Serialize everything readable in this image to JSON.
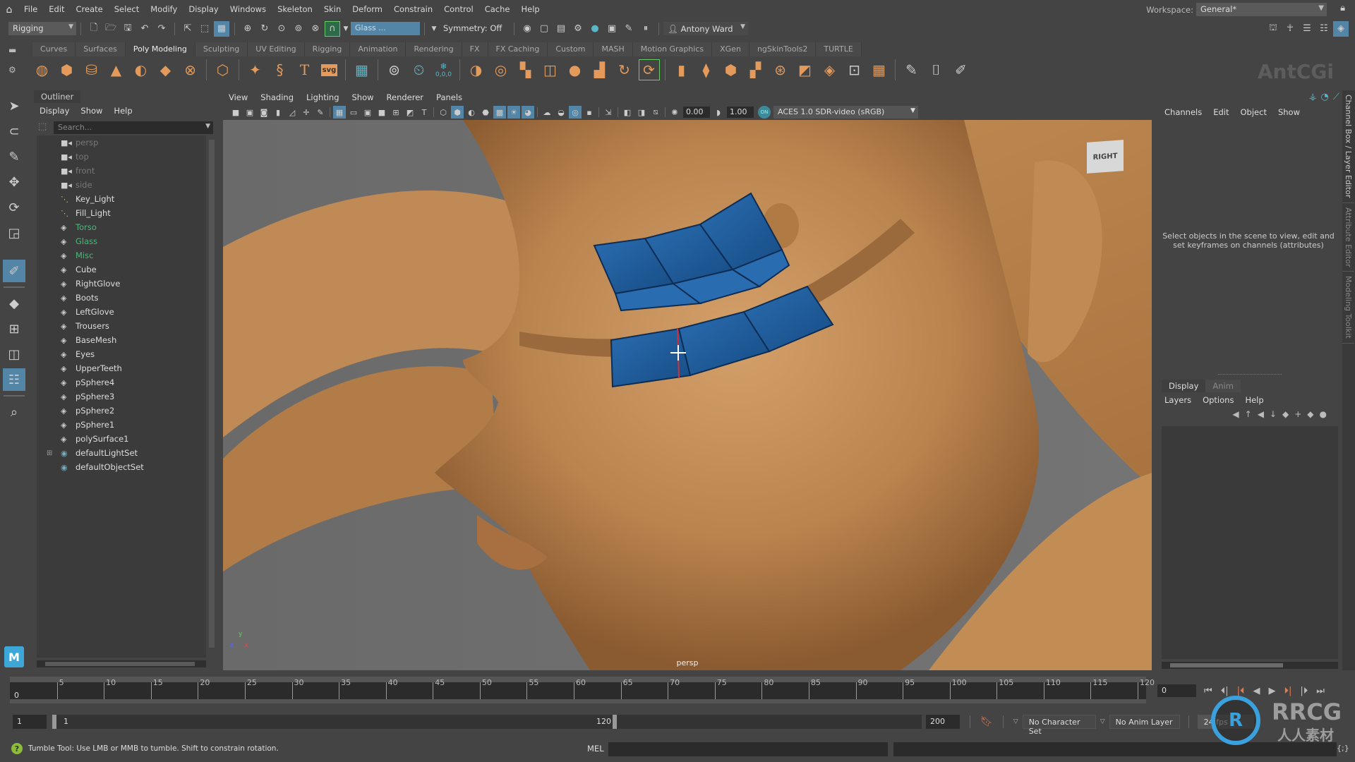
{
  "menubar": {
    "items": [
      "File",
      "Edit",
      "Create",
      "Select",
      "Modify",
      "Display",
      "Windows",
      "Skeleton",
      "Skin",
      "Deform",
      "Constrain",
      "Control",
      "Cache",
      "Help"
    ],
    "workspace_label": "Workspace:",
    "workspace_value": "General*"
  },
  "statusline": {
    "mode": "Rigging",
    "selection_field": "Glass ...",
    "symmetry": "Symmetry: Off",
    "user": "Antony Ward"
  },
  "shelf": {
    "tabs": [
      "Curves",
      "Surfaces",
      "Poly Modeling",
      "Sculpting",
      "UV Editing",
      "Rigging",
      "Animation",
      "Rendering",
      "FX",
      "FX Caching",
      "Custom",
      "MASH",
      "Motion Graphics",
      "XGen",
      "ngSkinTools2",
      "TURTLE"
    ],
    "active_tab": "Poly Modeling",
    "reset_label": "0,0,0",
    "svg_label": "svg"
  },
  "outliner": {
    "title": "Outliner",
    "menu": [
      "Display",
      "Show",
      "Help"
    ],
    "search_placeholder": "Search...",
    "items": [
      {
        "name": "persp",
        "type": "camera",
        "style": "dim"
      },
      {
        "name": "top",
        "type": "camera",
        "style": "dim"
      },
      {
        "name": "front",
        "type": "camera",
        "style": "dim"
      },
      {
        "name": "side",
        "type": "camera",
        "style": "dim"
      },
      {
        "name": "Key_Light",
        "type": "light",
        "style": "normal"
      },
      {
        "name": "Fill_Light",
        "type": "light",
        "style": "normal"
      },
      {
        "name": "Torso",
        "type": "mesh",
        "style": "green"
      },
      {
        "name": "Glass",
        "type": "mesh",
        "style": "green"
      },
      {
        "name": "Misc",
        "type": "mesh",
        "style": "green"
      },
      {
        "name": "Cube",
        "type": "mesh",
        "style": "normal"
      },
      {
        "name": "RightGlove",
        "type": "mesh",
        "style": "normal"
      },
      {
        "name": "Boots",
        "type": "mesh",
        "style": "normal"
      },
      {
        "name": "LeftGlove",
        "type": "mesh",
        "style": "normal"
      },
      {
        "name": "Trousers",
        "type": "mesh",
        "style": "normal"
      },
      {
        "name": "BaseMesh",
        "type": "mesh",
        "style": "normal"
      },
      {
        "name": "Eyes",
        "type": "mesh",
        "style": "normal"
      },
      {
        "name": "UpperTeeth",
        "type": "mesh",
        "style": "normal"
      },
      {
        "name": "pSphere4",
        "type": "mesh",
        "style": "normal"
      },
      {
        "name": "pSphere3",
        "type": "mesh",
        "style": "normal"
      },
      {
        "name": "pSphere2",
        "type": "mesh",
        "style": "normal"
      },
      {
        "name": "pSphere1",
        "type": "mesh",
        "style": "normal"
      },
      {
        "name": "polySurface1",
        "type": "mesh",
        "style": "normal"
      },
      {
        "name": "defaultLightSet",
        "type": "set",
        "style": "normal",
        "expandable": true
      },
      {
        "name": "defaultObjectSet",
        "type": "set",
        "style": "normal"
      }
    ]
  },
  "viewport": {
    "menu": [
      "View",
      "Shading",
      "Lighting",
      "Show",
      "Renderer",
      "Panels"
    ],
    "exposure": "0.00",
    "gamma": "1.00",
    "colorspace_toggle": "ON",
    "colorspace": "ACES 1.0 SDR-video (sRGB)",
    "camera_label": "persp",
    "viewcube_label": "RIGHT",
    "axis": {
      "y": "y",
      "z": "z",
      "x": "x"
    }
  },
  "channelbox": {
    "menu": [
      "Channels",
      "Edit",
      "Object",
      "Show"
    ],
    "message": "Select objects in the scene to view, edit and set keyframes on channels (attributes)"
  },
  "layereditor": {
    "tabs": [
      "Display",
      "Anim"
    ],
    "active_tab": "Display",
    "menu": [
      "Layers",
      "Options",
      "Help"
    ]
  },
  "sidetabs": [
    "Channel Box / Layer Editor",
    "Attribute Editor",
    "Modeling Toolkit"
  ],
  "timeline": {
    "ticks": [
      5,
      10,
      15,
      20,
      25,
      30,
      35,
      40,
      45,
      50,
      55,
      60,
      65,
      70,
      75,
      80,
      85,
      90,
      95,
      100,
      105,
      110,
      115,
      120
    ],
    "range": [
      0,
      120
    ],
    "current_frame_label": "0",
    "current_frame_field": "0"
  },
  "range": {
    "start": "1",
    "inner_start": "1",
    "inner_end": "120",
    "end": "200",
    "character_set": "No Character Set",
    "anim_layer": "No Anim Layer",
    "fps": "24 fps"
  },
  "helpline": {
    "text": "Tumble Tool: Use LMB or MMB to tumble. Shift to constrain rotation.",
    "mel_label": "MEL"
  },
  "watermark": {
    "text": "RRCG",
    "sub": "人人素材",
    "badge": "R"
  },
  "colors": {
    "accent": "#5285a6",
    "shelf_icon": "#e39a5a",
    "selected_face": "#1f5d99",
    "skin": "#c18a52",
    "green_item": "#4db77a"
  }
}
